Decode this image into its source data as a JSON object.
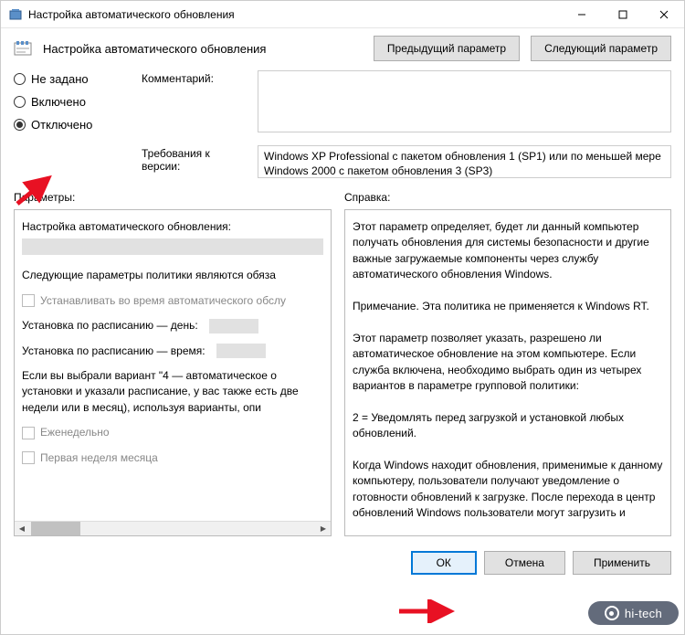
{
  "titlebar": {
    "title": "Настройка автоматического обновления"
  },
  "header": {
    "title": "Настройка автоматического обновления",
    "prev_btn": "Предыдущий параметр",
    "next_btn": "Следующий параметр"
  },
  "radios": {
    "not_configured": "Не задано",
    "enabled": "Включено",
    "disabled": "Отключено"
  },
  "fields": {
    "comment_label": "Комментарий:",
    "req_label": "Требования к версии:",
    "req_text": "Windows XP Professional с пакетом обновления 1 (SP1) или по меньшей мере Windows 2000 с пакетом обновления 3 (SP3)"
  },
  "panes": {
    "left_label": "Параметры:",
    "right_label": "Справка:"
  },
  "left_pane": {
    "title": "Настройка автоматического обновления:",
    "policy_line": "Следующие параметры политики являются обяза",
    "install_maint": "Устанавливать во время автоматического обслу",
    "sched_day": "Установка по расписанию — день:",
    "sched_time": "Установка по расписанию — время:",
    "variant4": "Если вы выбрали вариант \"4 — автоматическое о установки и указали расписание, у вас также есть две недели или в месяц), используя варианты, опи",
    "weekly": "Еженедельно",
    "first_week": "Первая неделя месяца"
  },
  "right_pane": {
    "p1": "Этот параметр определяет, будет ли данный компьютер получать обновления для системы безопасности и другие важные загружаемые компоненты через службу автоматического обновления Windows.",
    "p2": "Примечание. Эта политика не применяется к Windows RT.",
    "p3": "Этот параметр позволяет указать, разрешено ли автоматическое обновление на этом компьютере. Если служба включена, необходимо выбрать один из четырех вариантов в параметре групповой политики:",
    "p4": " 2 = Уведомлять перед загрузкой и установкой любых обновлений.",
    "p5": " Когда Windows находит обновления, применимые к данному компьютеру, пользователи получают уведомление о готовности обновлений к загрузке. После перехода в центр обновлений Windows пользователи могут загрузить и"
  },
  "buttons": {
    "ok": "ОК",
    "cancel": "Отмена",
    "apply": "Применить"
  },
  "watermark": "hi-tech"
}
